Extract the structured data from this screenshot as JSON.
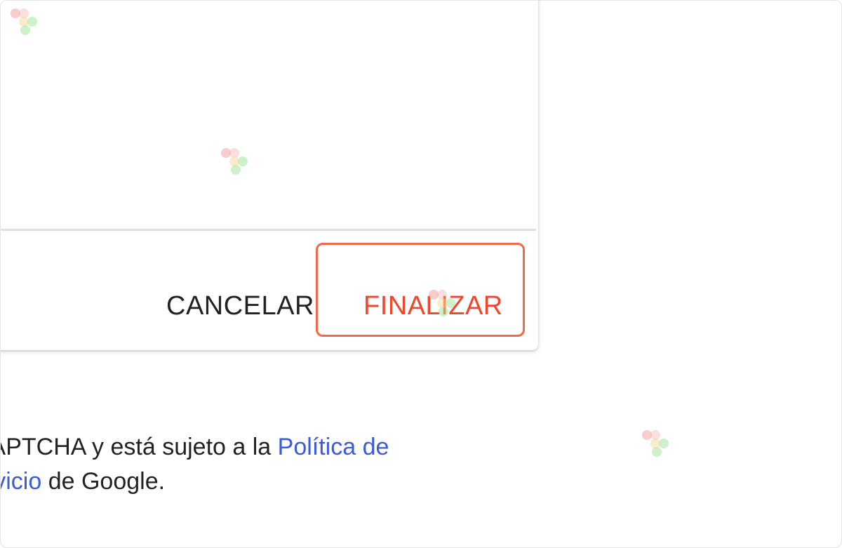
{
  "dialog": {
    "cancel_label": "CANCELAR",
    "finish_label": "FINALIZAR"
  },
  "footer": {
    "text_before": "CAPTCHA y está sujeto a la ",
    "link_policy": "Política de",
    "link_service": "ervicio",
    "text_after": " de Google."
  },
  "colors": {
    "finish": "#f0472c",
    "link": "#3b5bdb",
    "highlight": "#ef6a45"
  },
  "icons": [
    "cursor-marker-icon"
  ]
}
